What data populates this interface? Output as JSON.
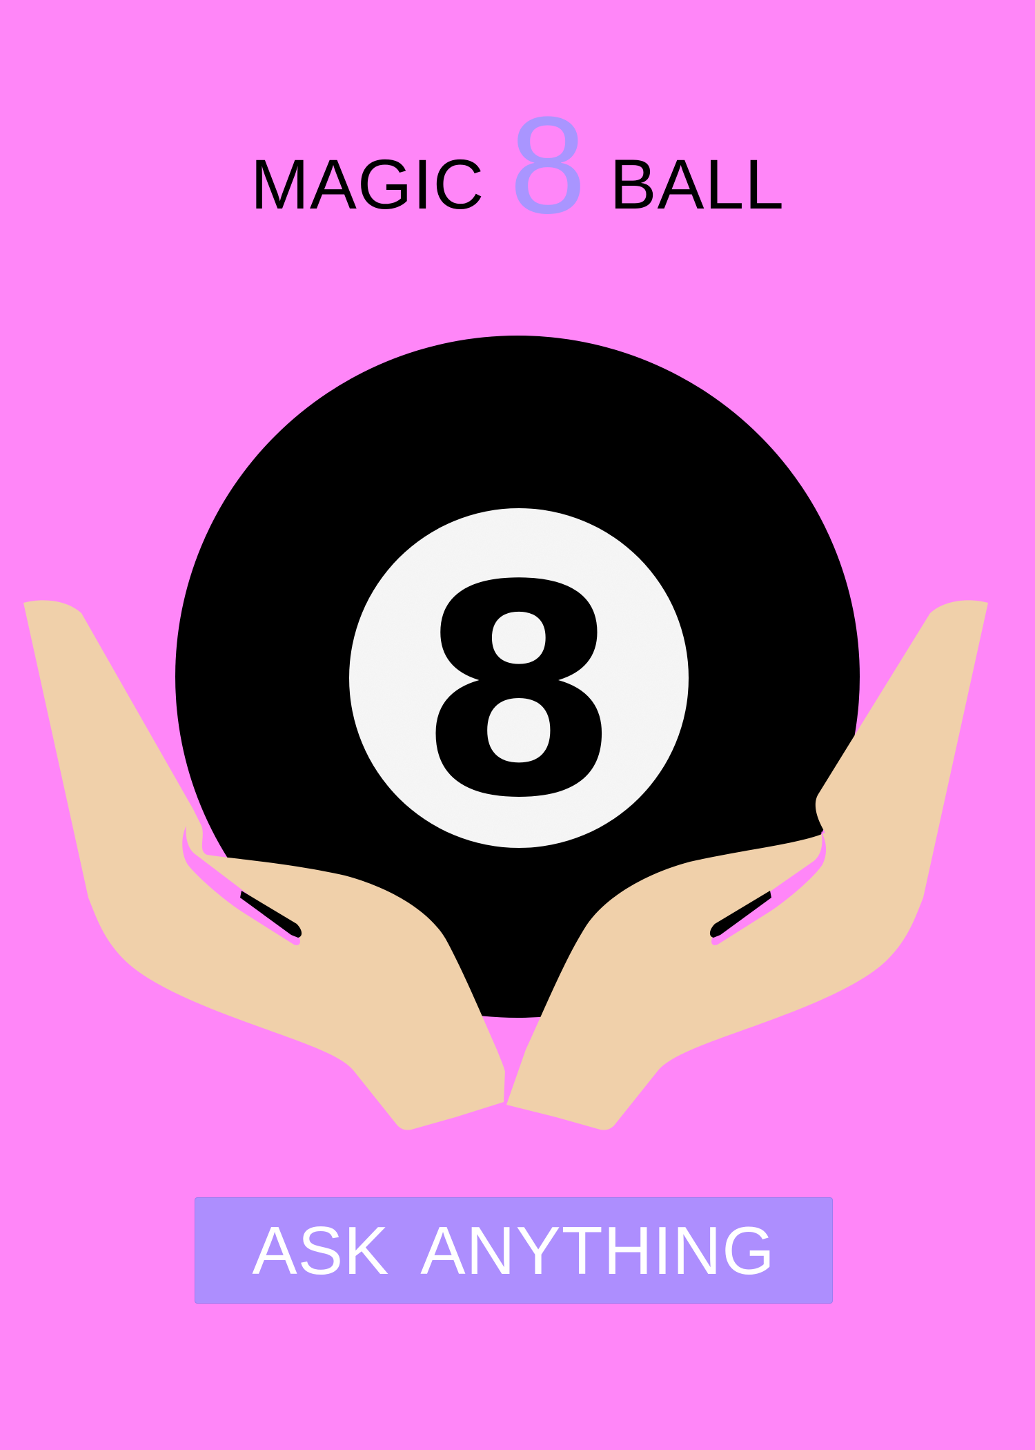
{
  "header": {
    "title_left": "MAGIC",
    "title_number": "8",
    "title_right": "BALL"
  },
  "ball": {
    "number": "8"
  },
  "ask_button": {
    "label": "ASK ANYTHING"
  },
  "colors": {
    "background": "#ff86f8",
    "accent": "#ad8efe",
    "title_number": "#a995ff",
    "ball": "#000000",
    "hands": "#f0d0aa"
  },
  "icons": [
    "magic-8-ball-icon",
    "hands-icon"
  ]
}
